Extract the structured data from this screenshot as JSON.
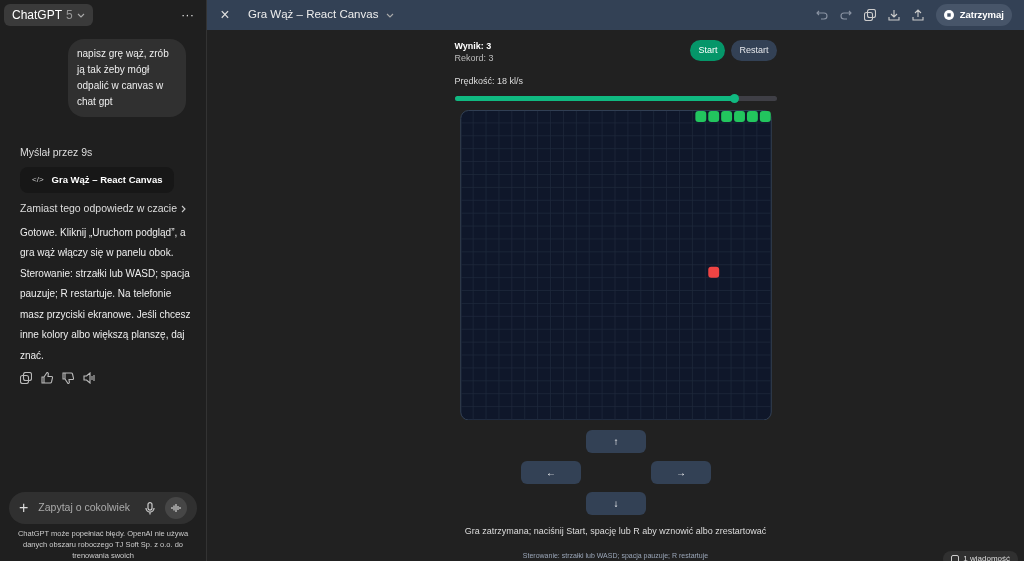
{
  "sidebar": {
    "model_button": {
      "label": "ChatGPT",
      "version": "5"
    },
    "more_label": "···",
    "user_message": "napisz grę wąż, zrób ją tak żeby mógł odpalić w canvas w chat gpt",
    "thought_label": "Myślał przez 9s",
    "canvas_chip": {
      "icon": "</>",
      "label": "Gra Wąż – React Canvas"
    },
    "answer_link": "Zamiast tego odpowiedz w czacie",
    "answer": "Gotowe. Kliknij „Uruchom podgląd”, a gra wąż włączy się w panelu obok. Sterowanie: strzałki lub WASD; spacja pauzuje; R restartuje. Na telefonie masz przyciski ekranowe. Jeśli chcesz inne kolory albo większą planszę, daj znać.",
    "composer": {
      "plus": "+",
      "placeholder": "Zapytaj o cokolwiek"
    },
    "disclaimer": "ChatGPT może popełniać błędy. OpenAI nie używa danych obszaru roboczego TJ Soft Sp. z o.o. do trenowania swoich"
  },
  "header": {
    "close": "×",
    "title": "Gra Wąż – React Canvas",
    "stop_button": "Zatrzymaj"
  },
  "game": {
    "score": "Wynik: 3",
    "record": "Rekord: 3",
    "buttons": [
      {
        "label": "Start",
        "kind": "primary"
      },
      {
        "label": "Restart",
        "kind": "secondary"
      }
    ],
    "speed": {
      "label": "Prędkość: 18 kl/s",
      "level": 0.87
    },
    "arrows": [
      {
        "label": "↑",
        "kind": "up"
      },
      {
        "label": "←",
        "kind": "left"
      },
      {
        "label": "→",
        "kind": "right"
      },
      {
        "label": "↓",
        "kind": "down"
      }
    ],
    "status": "Gra zatrzymana; naciśnij Start, spację lub R aby wznowić albo zrestartować",
    "hint": "Sterowanie: strzałki lub WASD; spacja pauzuje; R restartuje"
  },
  "message_badge": "1 wiadomość"
}
